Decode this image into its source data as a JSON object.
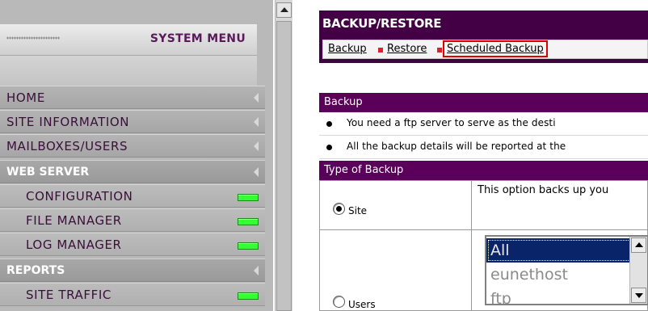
{
  "system_menu": {
    "title": "SYSTEM MENU",
    "items": [
      {
        "label": "HOME",
        "kind": "main",
        "indicator": "arrow"
      },
      {
        "label": "SITE INFORMATION",
        "kind": "main",
        "indicator": "arrow"
      },
      {
        "label": "MAILBOXES/USERS",
        "kind": "main",
        "indicator": "arrow"
      },
      {
        "label": "WEB SERVER",
        "kind": "section",
        "indicator": "arrow"
      },
      {
        "label": "CONFIGURATION",
        "kind": "sub",
        "indicator": "green-led"
      },
      {
        "label": "FILE MANAGER",
        "kind": "sub",
        "indicator": "green-led"
      },
      {
        "label": "LOG MANAGER",
        "kind": "sub",
        "indicator": "green-led"
      },
      {
        "label": "REPORTS",
        "kind": "section",
        "indicator": "arrow"
      },
      {
        "label": "SITE TRAFFIC",
        "kind": "sub",
        "indicator": "green-led"
      }
    ]
  },
  "page": {
    "title": "BACKUP/RESTORE",
    "tabs": [
      {
        "label": "Backup",
        "selected": false
      },
      {
        "label": "Restore",
        "selected": false
      },
      {
        "label": "Scheduled Backup",
        "selected": true
      }
    ]
  },
  "backup_section": {
    "heading": "Backup",
    "bullets": [
      "You need a ftp server to serve as the desti",
      "All the backup details will be reported at the"
    ]
  },
  "type_section": {
    "heading": "Type of Backup",
    "options": [
      {
        "label": "Site",
        "checked": true,
        "description": "This option backs up you"
      },
      {
        "label": "Users",
        "checked": false
      }
    ],
    "user_list": {
      "items": [
        "All",
        "eunethost",
        "ftp"
      ],
      "selected": "All"
    }
  },
  "colors": {
    "menu_text": "#3a0f3a",
    "header_purple": "#440044",
    "section_purple": "#5a005a",
    "led_green": "#33ff33",
    "tab_highlight": "#e00000",
    "selection_blue": "#0a246a"
  }
}
